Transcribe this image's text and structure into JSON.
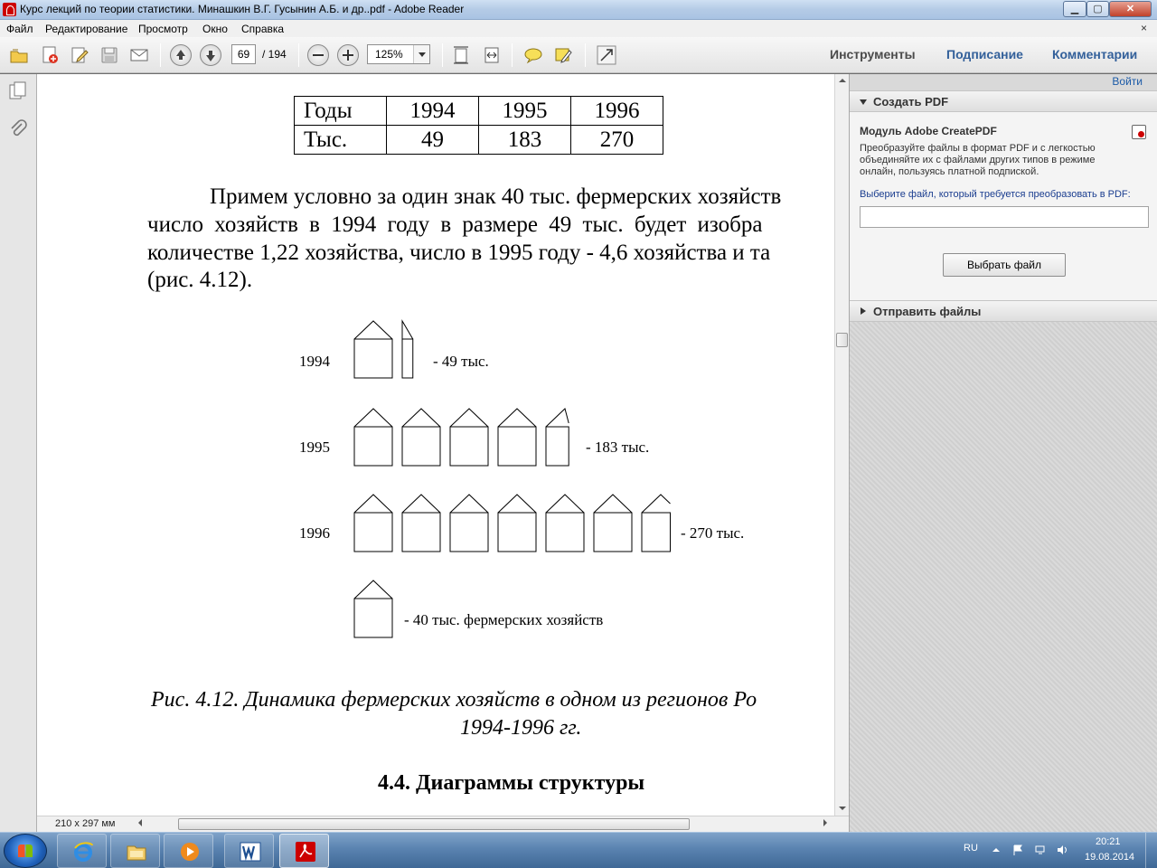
{
  "window": {
    "title": "Курс лекций по теории статистики. Минашкин В.Г. Гусынин А.Б. и др..pdf - Adobe Reader"
  },
  "menu": [
    "Файл",
    "Редактирование",
    "Просмотр",
    "Окно",
    "Справка"
  ],
  "toolbar": {
    "page_current": "69",
    "page_total": "/ 194",
    "zoom": "125%",
    "pane_tabs": [
      "Инструменты",
      "Подписание",
      "Комментарии"
    ]
  },
  "document": {
    "table": {
      "header": [
        "Годы",
        "1994",
        "1995",
        "1996"
      ],
      "row": [
        "Тыс.",
        "49",
        "183",
        "270"
      ]
    },
    "paragraph": [
      "Примем условно за один знак 40 тыс. фермерских хозяйств",
      "число хозяйств в 1994 году в размере 49 тыс. будет изобра",
      "количестве 1,22 хозяйства, число в 1995 году - 4,6 хозяйства и та",
      "(рис. 4.12)."
    ],
    "figure": {
      "rows": [
        {
          "year": "1994",
          "label": "- 49 тыс.",
          "value": 49,
          "icons": 1.22
        },
        {
          "year": "1995",
          "label": "- 183 тыс.",
          "value": 183,
          "icons": 4.6
        },
        {
          "year": "1996",
          "label": "- 270 тыс.",
          "value": 270,
          "icons": 6.75
        }
      ],
      "legend": "- 40 тыс. фермерских хозяйств",
      "unit_per_icon": 40
    },
    "caption_line1": "Рис. 4.12. Динамика фермерских хозяйств в одном из регионов Ро",
    "caption_line2": "1994-1996 гг.",
    "section_heading": "4.4. Диаграммы структуры"
  },
  "status": {
    "page_size": "210 x 297 мм"
  },
  "right_pane": {
    "views_link": "Войти",
    "create_pdf_title": "Создать PDF",
    "module_title": "Модуль Adobe CreatePDF",
    "description": [
      "Преобразуйте файлы в формат PDF и с легкостью",
      "объединяйте их с файлами других типов в режиме",
      "онлайн, пользуясь платной подпиской."
    ],
    "choose_label": "Выберите файл, который требуется преобразовать в PDF:",
    "choose_button": "Выбрать файл",
    "send_files_title": "Отправить файлы"
  },
  "taskbar": {
    "lang": "RU",
    "time": "20:21",
    "date": "19.08.2014"
  },
  "colors": {
    "accent_link": "#1c5ba8",
    "active_tab": "#33609a",
    "adobe_red": "#cc0000"
  }
}
